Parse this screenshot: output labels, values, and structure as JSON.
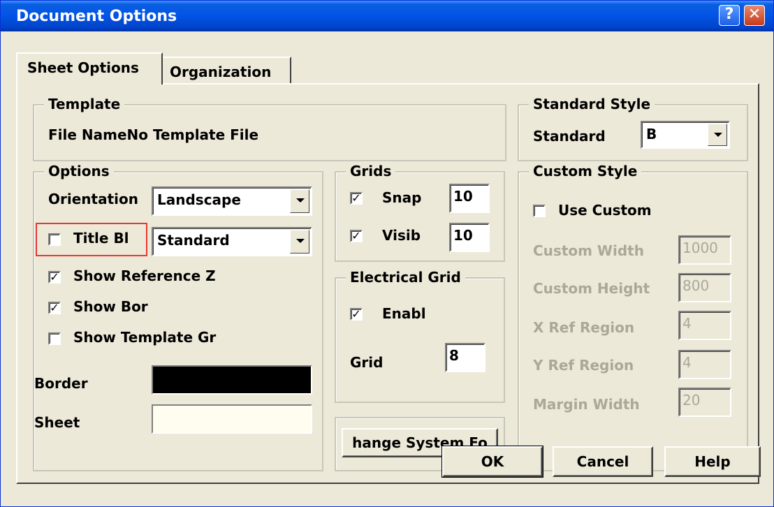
{
  "window": {
    "title": "Document Options"
  },
  "titlebar": {
    "help": "?",
    "close": "✕"
  },
  "tabs": [
    {
      "label": "Sheet Options"
    },
    {
      "label": "Organization"
    }
  ],
  "template": {
    "legend": "Template",
    "file_name_label": "File Name",
    "file_name_value": "No Template File"
  },
  "standard_style": {
    "legend": "Standard Style",
    "label": "Standard",
    "value": "B"
  },
  "options": {
    "legend": "Options",
    "orientation_label": "Orientation",
    "orientation_value": "Landscape",
    "title_block_label": "Title Bl",
    "title_block_checked": false,
    "title_block_value": "Standard",
    "show_reference_zones": {
      "label": "Show Reference Z",
      "checked": true
    },
    "show_border": {
      "label": "Show Bor",
      "checked": true
    },
    "show_template_graphics": {
      "label": "Show Template Gr",
      "checked": false
    },
    "border_label": "Border",
    "border_color": "#000000",
    "sheet_label": "Sheet",
    "sheet_color": "#fffcf0"
  },
  "grids": {
    "legend": "Grids",
    "snap": {
      "label": "Snap",
      "checked": true,
      "value": "10"
    },
    "visible": {
      "label": "Visib",
      "checked": true,
      "value": "10"
    }
  },
  "electrical_grid": {
    "legend": "Electrical Grid",
    "enable": {
      "label": "Enabl",
      "checked": true
    },
    "grid_label": "Grid",
    "grid_value": "8"
  },
  "change_font_button": "hange System Fo",
  "custom_style": {
    "legend": "Custom Style",
    "use_custom": {
      "label": "Use Custom",
      "checked": false
    },
    "custom_width": {
      "label": "Custom Width",
      "value": "1000"
    },
    "custom_height": {
      "label": "Custom Height",
      "value": "800"
    },
    "x_ref_region": {
      "label": "X Ref Region",
      "value": "4"
    },
    "y_ref_region": {
      "label": "Y Ref Region",
      "value": "4"
    },
    "margin_width": {
      "label": "Margin Width",
      "value": "20"
    }
  },
  "footer": {
    "ok": "OK",
    "cancel": "Cancel",
    "help": "Help"
  },
  "checkmark": "✓"
}
